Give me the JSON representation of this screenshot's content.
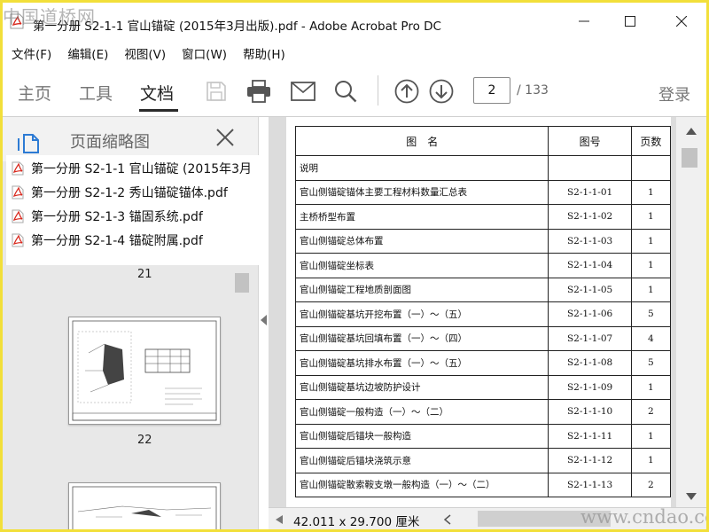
{
  "window": {
    "title": "第一分册 S2-1-1 官山锚碇 (2015年3月出版).pdf - Adobe Acrobat Pro DC"
  },
  "menu": [
    "文件(F)",
    "编辑(E)",
    "视图(V)",
    "窗口(W)",
    "帮助(H)"
  ],
  "toolbar": {
    "tabs": [
      "主页",
      "工具",
      "文档"
    ],
    "active_tab": "文档",
    "current_page": "2",
    "total_pages": "/ 133",
    "sign_in": "登录"
  },
  "left_panel": {
    "title": "页面缩略图",
    "attachments": [
      "第一分册 S2-1-1 官山锚碇 (2015年3月",
      "第一分册 S2-1-2 秀山锚碇锚体.pdf",
      "第一分册 S2-1-3 锚固系统.pdf",
      "第一分册 S2-1-4 锚碇附属.pdf"
    ],
    "thumbnail_labels": [
      "21",
      "22"
    ]
  },
  "document": {
    "headers": [
      "图　名",
      "图号",
      "页数"
    ],
    "rows": [
      {
        "name": "说明",
        "code": "",
        "pages": ""
      },
      {
        "name": "官山侧锚碇锚体主要工程材料数量汇总表",
        "code": "S2-1-1-01",
        "pages": "1"
      },
      {
        "name": "主桥桥型布置",
        "code": "S2-1-1-02",
        "pages": "1"
      },
      {
        "name": "官山侧锚碇总体布置",
        "code": "S2-1-1-03",
        "pages": "1"
      },
      {
        "name": "官山侧锚碇坐标表",
        "code": "S2-1-1-04",
        "pages": "1"
      },
      {
        "name": "官山侧锚碇工程地质剖面图",
        "code": "S2-1-1-05",
        "pages": "1"
      },
      {
        "name": "官山侧锚碇基坑开挖布置（一）～（五）",
        "code": "S2-1-1-06",
        "pages": "5"
      },
      {
        "name": "官山侧锚碇基坑回填布置（一）～（四）",
        "code": "S2-1-1-07",
        "pages": "4"
      },
      {
        "name": "官山侧锚碇基坑排水布置（一）～（五）",
        "code": "S2-1-1-08",
        "pages": "5"
      },
      {
        "name": "官山侧锚碇基坑边坡防护设计",
        "code": "S2-1-1-09",
        "pages": "1"
      },
      {
        "name": "官山侧锚碇一般构造（一）～（二）",
        "code": "S2-1-1-10",
        "pages": "2"
      },
      {
        "name": "官山侧锚碇后锚块一般构造",
        "code": "S2-1-1-11",
        "pages": "1"
      },
      {
        "name": "官山侧锚碇后锚块浇筑示意",
        "code": "S2-1-1-12",
        "pages": "1"
      },
      {
        "name": "官山侧锚碇散索鞍支墩一般构造（一）～（二）",
        "code": "S2-1-1-13",
        "pages": "2"
      }
    ]
  },
  "status": {
    "page_size": "42.011 x 29.700 厘米"
  },
  "watermarks": {
    "top_left": "中国道桥网",
    "bottom_right": "www.cndao.com"
  },
  "colors": {
    "frame_border": "#f2df3a",
    "pdf_icon_red": "#d8261b"
  }
}
